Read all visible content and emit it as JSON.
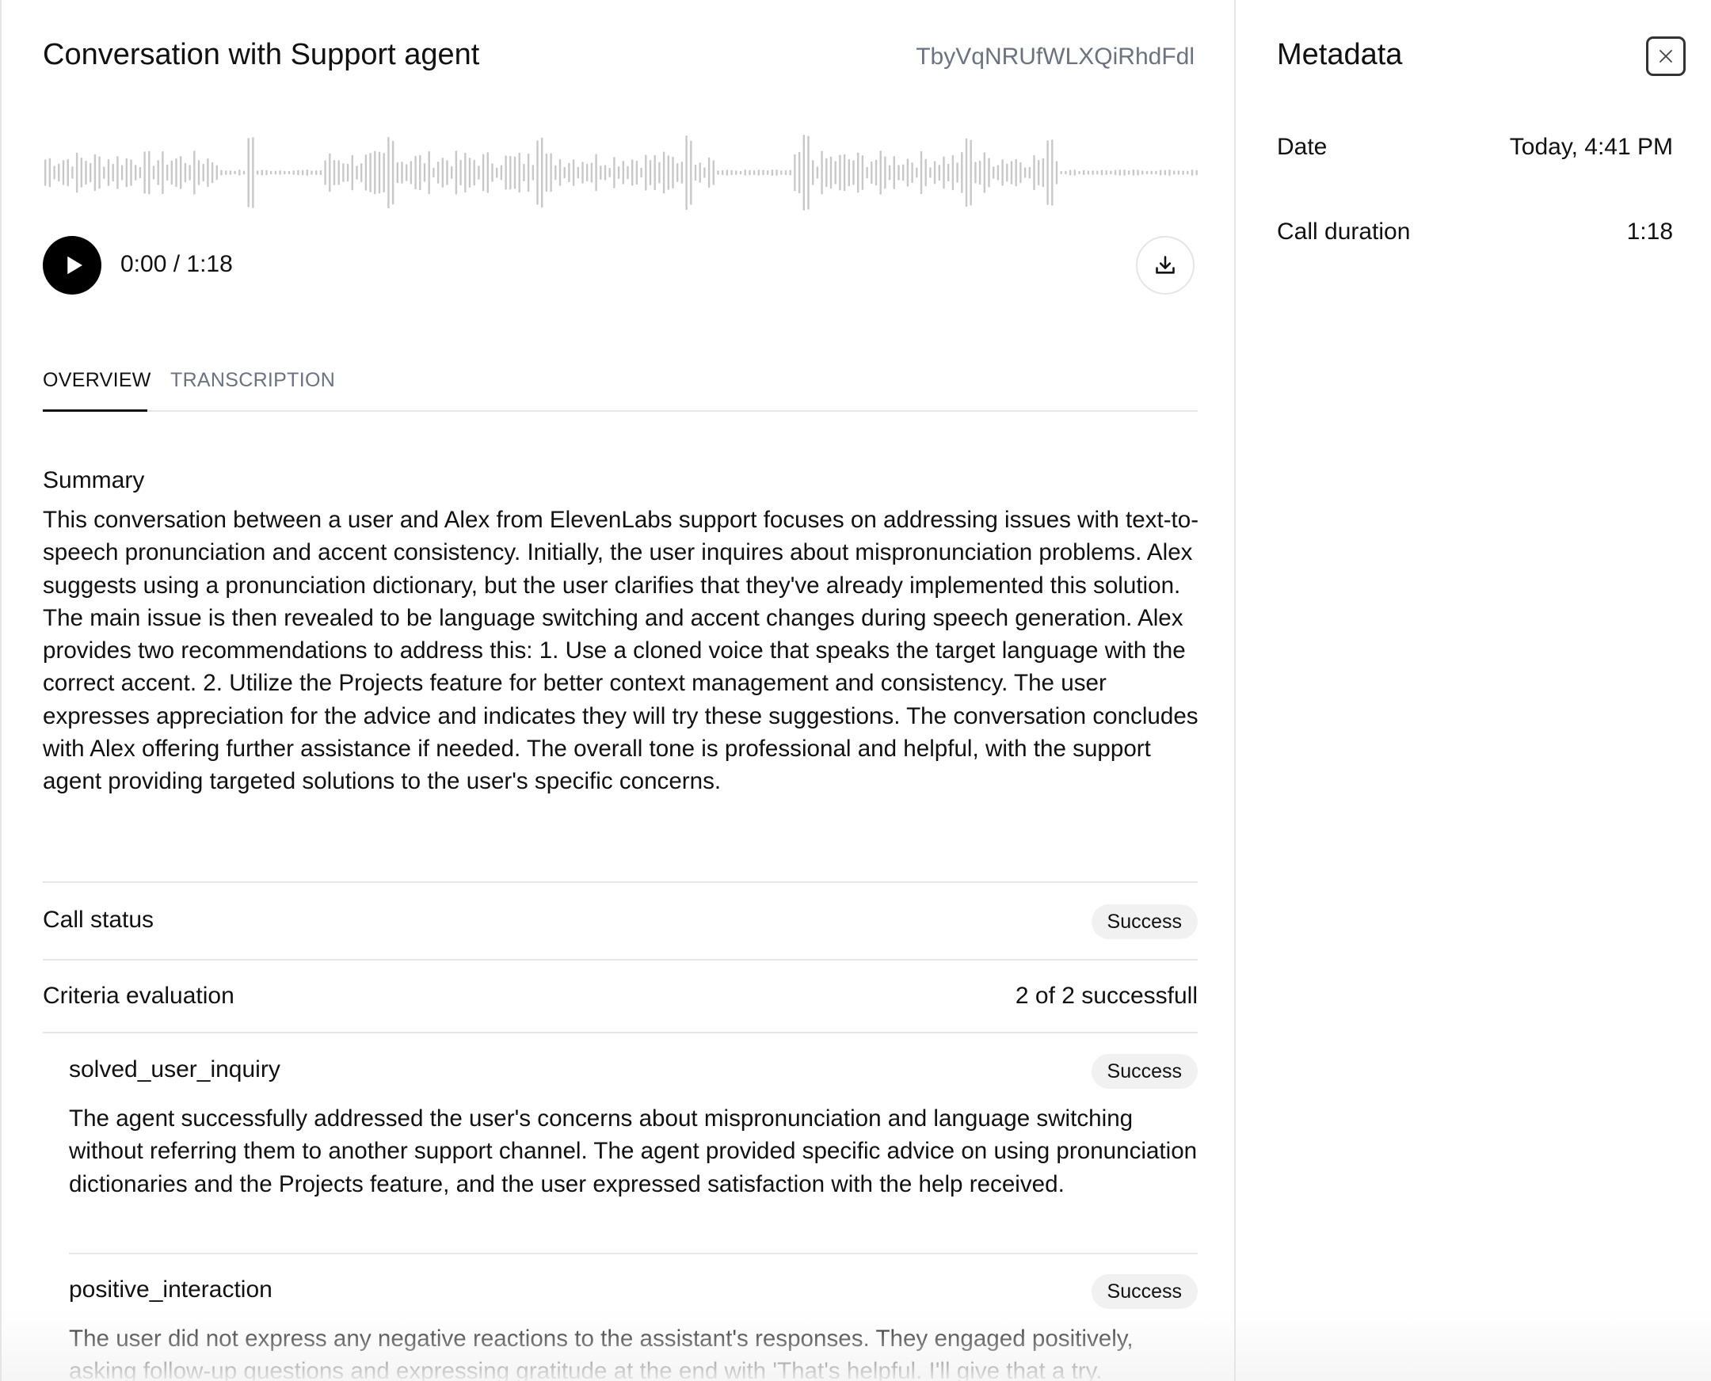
{
  "header": {
    "title": "Conversation with Support agent",
    "conversation_id": "TbyVqNRUfWLXQiRhdFdl"
  },
  "player": {
    "time": "0:00 / 1:18",
    "play_icon": "play-icon",
    "download_icon": "download-icon"
  },
  "tabs": [
    {
      "label": "OVERVIEW",
      "active": true
    },
    {
      "label": "TRANSCRIPTION",
      "active": false
    }
  ],
  "overview": {
    "summary_label": "Summary",
    "summary_text": "This conversation between a user and Alex from ElevenLabs support focuses on addressing issues with text-to-speech pronunciation and accent consistency. Initially, the user inquires about mispronunciation problems. Alex suggests using a pronunciation dictionary, but the user clarifies that they've already implemented this solution. The main issue is then revealed to be language switching and accent changes during speech generation. Alex provides two recommendations to address this: 1. Use a cloned voice that speaks the target language with the correct accent. 2. Utilize the Projects feature for better context management and consistency. The user expresses appreciation for the advice and indicates they will try these suggestions. The conversation concludes with Alex offering further assistance if needed. The overall tone is professional and helpful, with the support agent providing targeted solutions to the user's specific concerns.",
    "call_status_label": "Call status",
    "call_status_value": "Success",
    "criteria_label": "Criteria evaluation",
    "criteria_value": "2 of 2 successfull",
    "criteria": [
      {
        "name": "solved_user_inquiry",
        "status": "Success",
        "rationale": "The agent successfully addressed the user's concerns about mispronunciation and language switching without referring them to another support channel. The agent provided specific advice on using pronunciation dictionaries and the Projects feature, and the user expressed satisfaction with the help received."
      },
      {
        "name": "positive_interaction",
        "status": "Success",
        "rationale": "The user did not express any negative reactions to the assistant's responses. They engaged positively, asking follow-up questions and expressing gratitude at the end with 'That's helpful. I'll give that a try."
      }
    ]
  },
  "metadata": {
    "title": "Metadata",
    "close_icon": "close-icon",
    "rows": [
      {
        "label": "Date",
        "value": "Today, 4:41 PM"
      },
      {
        "label": "Call duration",
        "value": "1:18"
      }
    ]
  },
  "colors": {
    "text": "#111111",
    "muted": "#6b7280",
    "divider": "#e5e7eb",
    "badge_bg": "#f1f1f2",
    "waveform": "#c8c8c8"
  }
}
